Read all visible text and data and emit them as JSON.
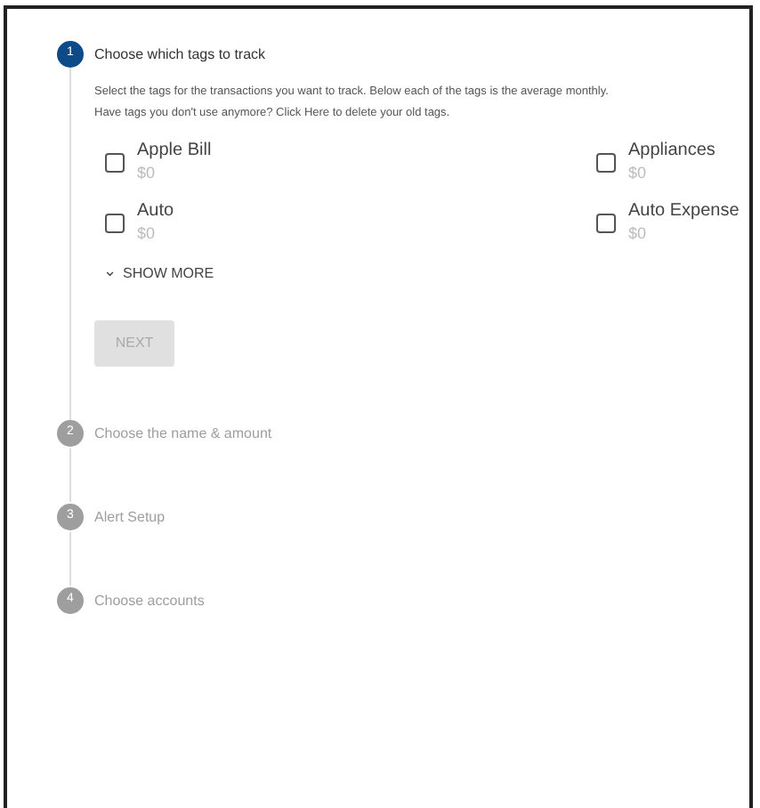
{
  "steps": [
    {
      "number": "1",
      "label": "Choose which tags to track",
      "active": true
    },
    {
      "number": "2",
      "label": "Choose the name & amount",
      "active": false
    },
    {
      "number": "3",
      "label": "Alert Setup",
      "active": false
    },
    {
      "number": "4",
      "label": "Choose accounts",
      "active": false
    }
  ],
  "description": [
    "Select the tags for the transactions you want to track. Below each of the tags is the average monthly.",
    "Have tags you don't use anymore? Click Here to delete your old tags."
  ],
  "tags": [
    {
      "name": "Apple Bill",
      "amount": "$0",
      "checked": false
    },
    {
      "name": "Appliances",
      "amount": "$0",
      "checked": false
    },
    {
      "name": "Auto",
      "amount": "$0",
      "checked": false
    },
    {
      "name": "Auto Expense",
      "amount": "$0",
      "checked": false
    }
  ],
  "show_more": {
    "caret": "⌄",
    "label": "SHOW MORE"
  },
  "next_button": {
    "label": "NEXT",
    "disabled": true
  }
}
